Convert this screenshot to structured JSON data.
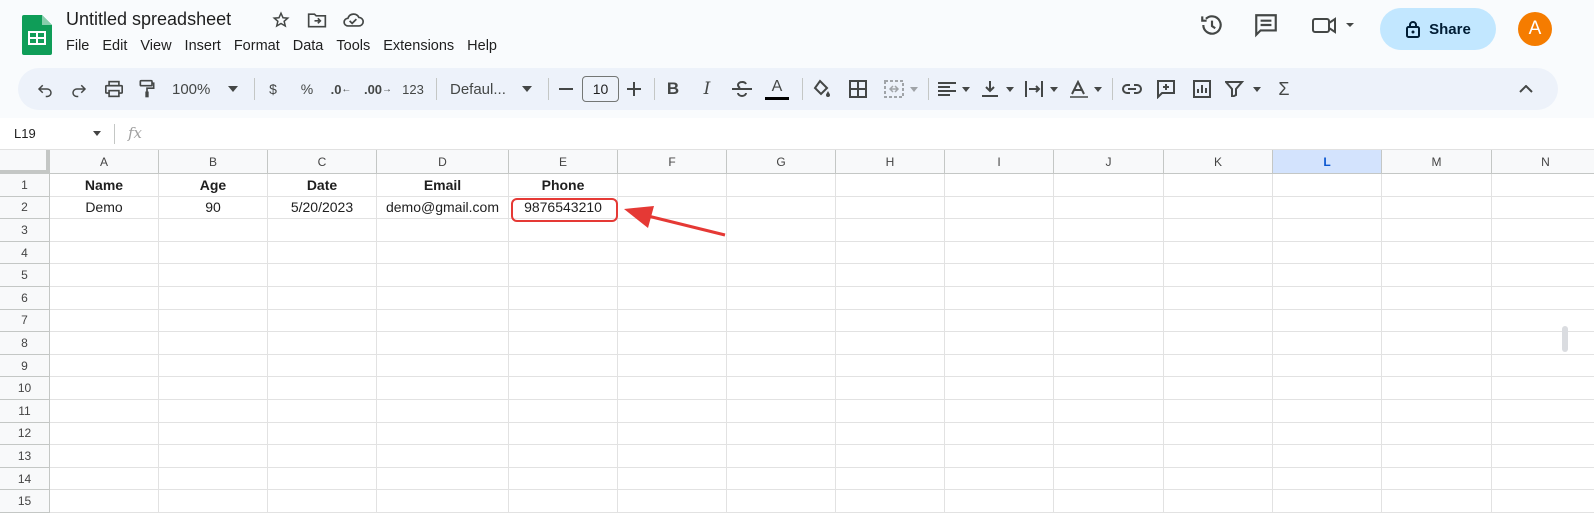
{
  "doc": {
    "title": "Untitled spreadsheet"
  },
  "menu": [
    "File",
    "Edit",
    "View",
    "Insert",
    "Format",
    "Data",
    "Tools",
    "Extensions",
    "Help"
  ],
  "header": {
    "share_label": "Share",
    "avatar_initial": "A"
  },
  "toolbar": {
    "zoom": "100%",
    "currency": "$",
    "percent": "%",
    "dec_decrease": ".0",
    "dec_increase": ".00",
    "number_format": "123",
    "font": "Defaul...",
    "font_size": "10",
    "bold": "B",
    "italic": "I",
    "text_color_glyph": "A",
    "sum": "Σ"
  },
  "formula_bar": {
    "cell_ref": "L19",
    "fx": "fx"
  },
  "columns": [
    "A",
    "B",
    "C",
    "D",
    "E",
    "F",
    "G",
    "H",
    "I",
    "J",
    "K",
    "L",
    "M",
    "N"
  ],
  "selected_column": "L",
  "rows": [
    "1",
    "2",
    "3",
    "4",
    "5",
    "6",
    "7",
    "8",
    "9",
    "10",
    "11",
    "12",
    "13",
    "14",
    "15"
  ],
  "cells": {
    "header_row": [
      "Name",
      "Age",
      "Date",
      "Email",
      "Phone"
    ],
    "data_row": [
      "Demo",
      "90",
      "5/20/2023",
      "demo@gmail.com",
      "9876543210"
    ]
  },
  "colors": {
    "accent": "#0b57d0",
    "share_bg": "#c2e7ff",
    "avatar": "#f57c00",
    "annotation": "#e53935",
    "sheets_green": "#0f9d58"
  }
}
